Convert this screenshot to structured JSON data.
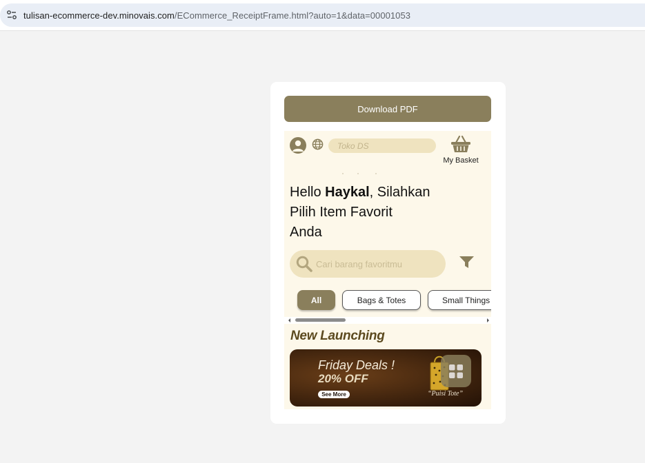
{
  "browser": {
    "url_host": "tulisan-ecommerce-dev.minovais.com",
    "url_path": "/ECommerce_ReceiptFrame.html?auto=1&data=00001053"
  },
  "card": {
    "download_label": "Download PDF"
  },
  "header": {
    "store_placeholder": "Toko DS",
    "basket_label": "My Basket"
  },
  "greeting": {
    "prefix": "Hello ",
    "name": "Haykal",
    "suffix_line1": ", Silahkan",
    "line2": "Pilih Item Favorit",
    "line3": "Anda"
  },
  "search": {
    "placeholder": "Cari barang favoritmu"
  },
  "categories": {
    "items": [
      "All",
      "Bags & Totes",
      "Small Things"
    ],
    "selected": "All"
  },
  "section": {
    "title": "New Launching"
  },
  "banner": {
    "title": "Friday Deals !",
    "discount": "20% OFF",
    "cta": "See More",
    "caption": "“Puisi Tote”"
  },
  "colors": {
    "accent": "#8a7f5c",
    "frame_bg": "#fdf8ea",
    "input_bg": "#efe3bf",
    "section_title": "#5c4a1f"
  }
}
